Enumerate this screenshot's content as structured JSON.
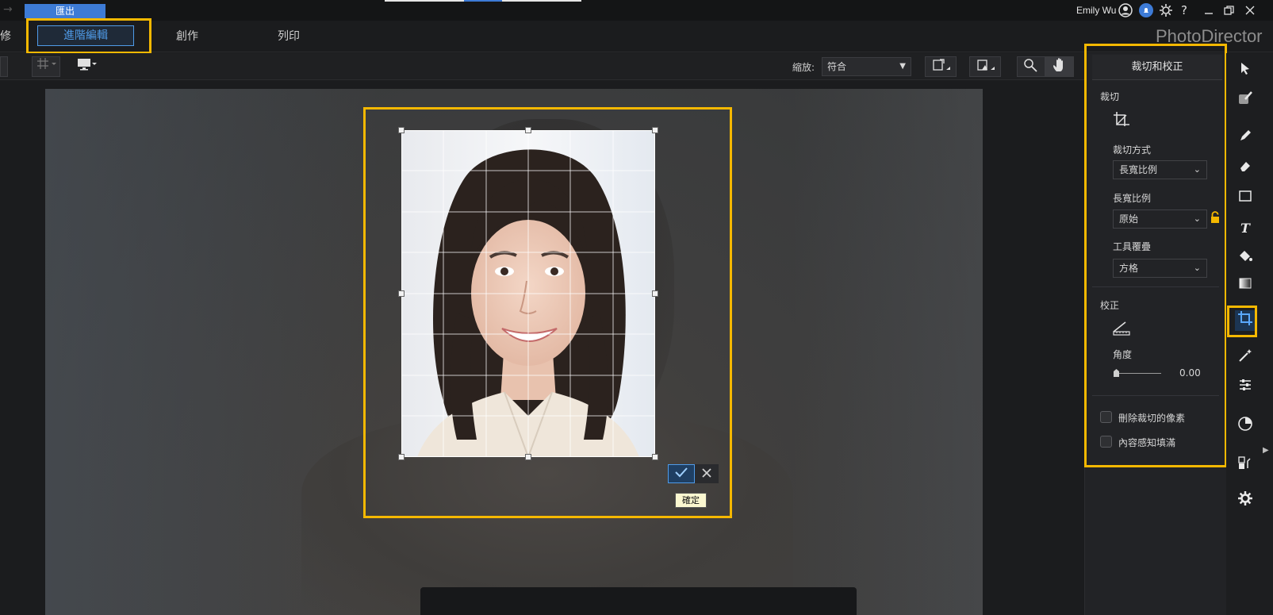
{
  "titlebar": {
    "export_label": "匯出",
    "user_name": "Emily Wu",
    "help": "?"
  },
  "tabs": {
    "partial_left": "修",
    "advanced": "進階編輯",
    "create": "創作",
    "print": "列印"
  },
  "brand": "PhotoDirector",
  "toolbar": {
    "zoom_label": "縮放:",
    "zoom_value": "符合"
  },
  "canvas": {
    "tooltip": "確定"
  },
  "panel": {
    "title": "裁切和校正",
    "crop_section": "裁切",
    "crop_method_label": "裁切方式",
    "crop_method_value": "長寬比例",
    "aspect_label": "長寬比例",
    "aspect_value": "原始",
    "overlay_label": "工具覆疊",
    "overlay_value": "方格",
    "straighten_section": "校正",
    "angle_label": "角度",
    "angle_value": "0.00",
    "delete_cropped_label": "刪除裁切的像素",
    "content_aware_label": "內容感知填滿"
  },
  "colors": {
    "accent": "#4f9be8",
    "highlight": "#f5b800",
    "export_tab": "#3d7bd6"
  }
}
